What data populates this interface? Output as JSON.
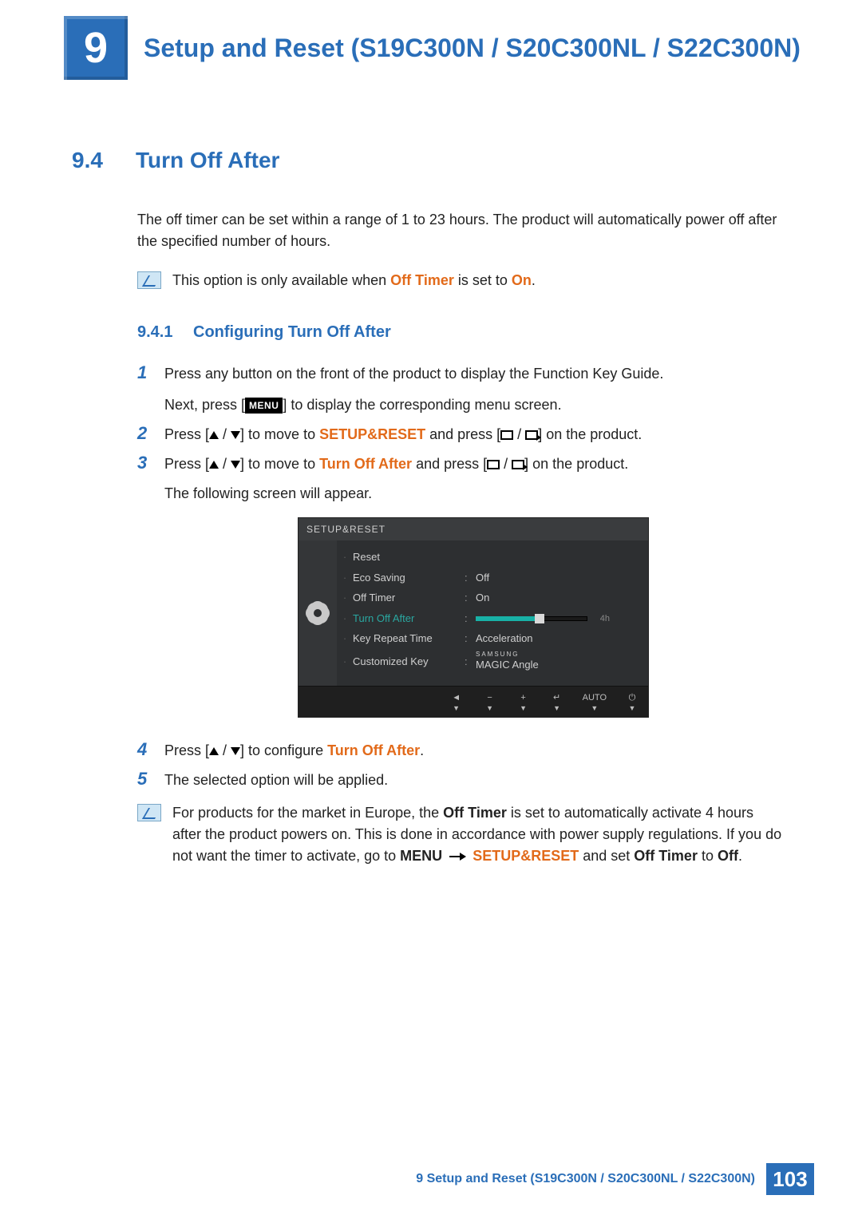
{
  "chapter": {
    "number": "9",
    "title": "Setup and Reset (S19C300N / S20C300NL / S22C300N)"
  },
  "section": {
    "number": "9.4",
    "title": "Turn Off After"
  },
  "intro": "The off timer can be set within a range of 1 to 23 hours. The product will automatically power off after the specified number of hours.",
  "note1": {
    "pre": "This option is only available when ",
    "off_timer": "Off Timer",
    "mid": " is set to ",
    "on": "On",
    "post": "."
  },
  "subsection": {
    "number": "9.4.1",
    "title": "Configuring Turn Off After"
  },
  "steps": {
    "s1a": "Press any button on the front of the product to display the Function Key Guide.",
    "s1b_pre": "Next, press [",
    "menu_key": "MENU",
    "s1b_post": "] to display the corresponding menu screen.",
    "s2_pre": "Press [",
    "s2_mid1": "] to move to ",
    "setup_reset": "SETUP&RESET",
    "s2_mid2": " and press [",
    "s2_post": "] on the product.",
    "s3_pre": "Press [",
    "s3_mid1": "] to move to ",
    "turn_off_after": "Turn Off After",
    "s3_mid2": " and press [",
    "s3_post": "] on the product.",
    "s3_line2": "The following screen will appear.",
    "s4_pre": "Press [",
    "s4_mid": "] to configure ",
    "s4_post": ".",
    "s5": "The selected option will be applied."
  },
  "osd": {
    "title": "SETUP&RESET",
    "rows": [
      {
        "label": "Reset",
        "value": ""
      },
      {
        "label": "Eco Saving",
        "value": "Off"
      },
      {
        "label": "Off Timer",
        "value": "On"
      },
      {
        "label": "Turn Off After",
        "value": "4h",
        "selected": true,
        "slider": true
      },
      {
        "label": "Key Repeat Time",
        "value": "Acceleration"
      },
      {
        "label": "Customized Key",
        "value": "MAGIC Angle",
        "magic": true,
        "brand": "SAMSUNG"
      }
    ],
    "footer": [
      "◄",
      "−",
      "+",
      "↵",
      "AUTO",
      "⏻"
    ]
  },
  "note2": {
    "line_pre": "For products for the market in Europe, the ",
    "off_timer": "Off Timer",
    "line_post1": " is set to automatically activate 4 hours after the product powers on. This is done in accordance with power supply regulations. If you do not want the timer to activate, go to ",
    "menu": "MENU",
    "setup_reset": "SETUP&RESET",
    "and_set": " and set ",
    "off_timer2": "Off Timer",
    "to": " to ",
    "off": "Off",
    "dot": "."
  },
  "footer": {
    "chapter_label": "9 Setup and Reset (S19C300N / S20C300NL / S22C300N)",
    "page": "103"
  }
}
